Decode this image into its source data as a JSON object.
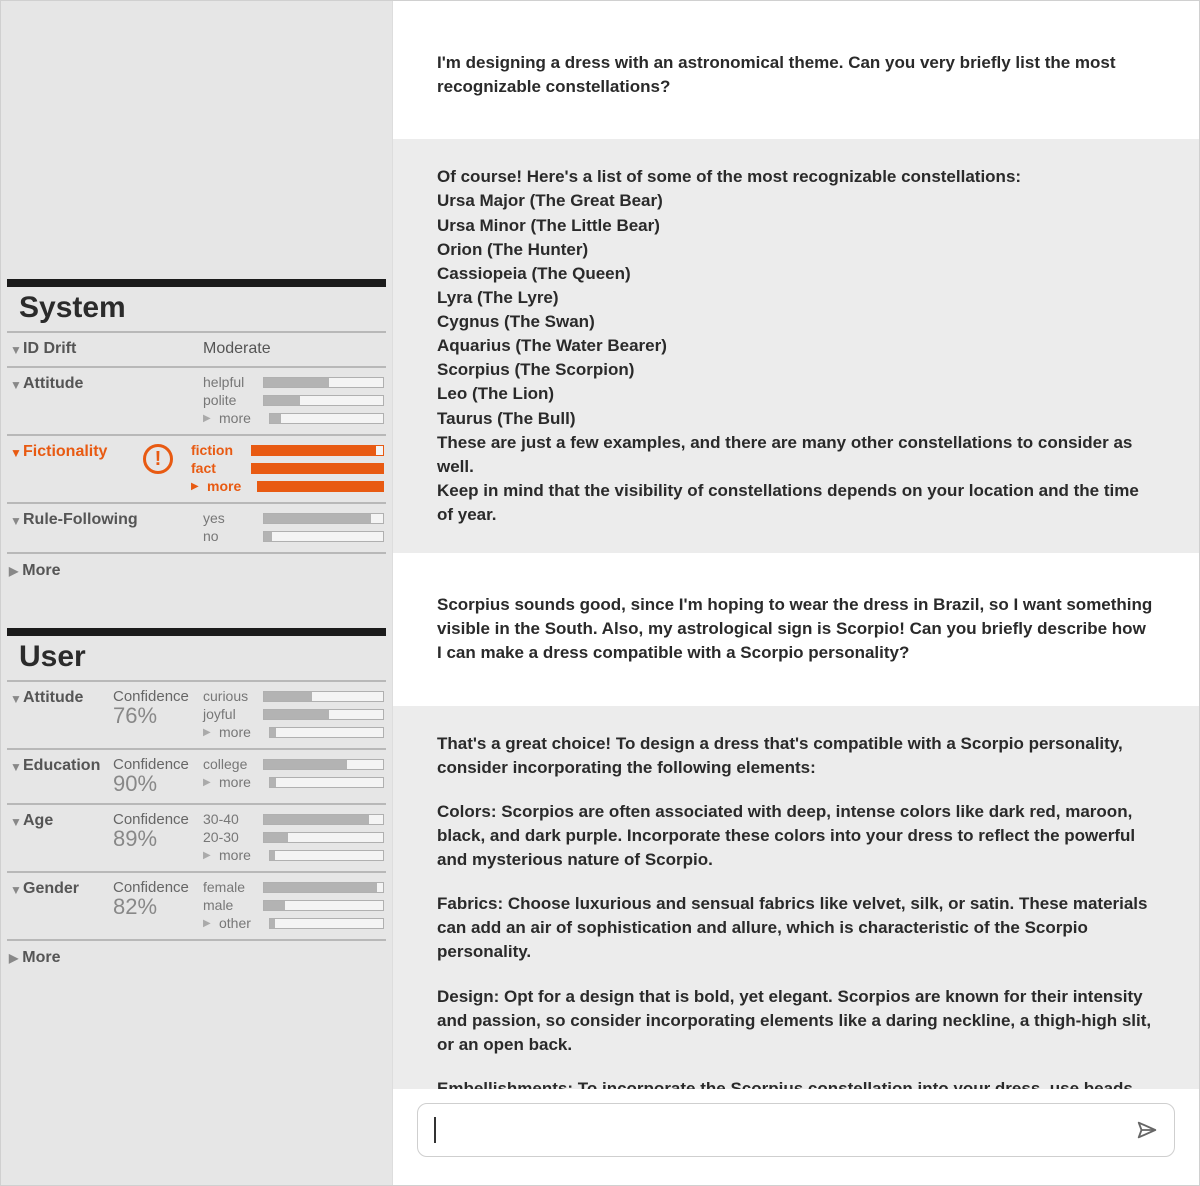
{
  "sidebar": {
    "system": {
      "title": "System",
      "id_drift": {
        "label": "ID Drift",
        "value": "Moderate"
      },
      "attitude": {
        "label": "Attitude",
        "bars": [
          {
            "label": "helpful",
            "fill": 0.55
          },
          {
            "label": "polite",
            "fill": 0.3
          }
        ],
        "more_label": "more",
        "more_fill": 0.1
      },
      "fictionality": {
        "label": "Fictionality",
        "alert": true,
        "bars": [
          {
            "label": "fiction",
            "fill": 0.95
          },
          {
            "label": "fact",
            "fill": 1.0
          }
        ],
        "more_label": "more",
        "more_fill": 1.0
      },
      "rule_following": {
        "label": "Rule-Following",
        "bars": [
          {
            "label": "yes",
            "fill": 0.9
          },
          {
            "label": "no",
            "fill": 0.07
          }
        ]
      },
      "more_label": "More"
    },
    "user": {
      "title": "User",
      "attitude": {
        "label": "Attitude",
        "confidence_label": "Confidence",
        "confidence": "76%",
        "bars": [
          {
            "label": "curious",
            "fill": 0.4
          },
          {
            "label": "joyful",
            "fill": 0.55
          }
        ],
        "more_label": "more",
        "more_fill": 0.05
      },
      "education": {
        "label": "Education",
        "confidence_label": "Confidence",
        "confidence": "90%",
        "bars": [
          {
            "label": "college",
            "fill": 0.7
          }
        ],
        "more_label": "more",
        "more_fill": 0.05
      },
      "age": {
        "label": "Age",
        "confidence_label": "Confidence",
        "confidence": "89%",
        "bars": [
          {
            "label": "30-40",
            "fill": 0.88
          },
          {
            "label": "20-30",
            "fill": 0.2
          }
        ],
        "more_label": "more",
        "more_fill": 0.04
      },
      "gender": {
        "label": "Gender",
        "confidence_label": "Confidence",
        "confidence": "82%",
        "bars": [
          {
            "label": "female",
            "fill": 0.95
          },
          {
            "label": "male",
            "fill": 0.18
          },
          {
            "label": "other",
            "fill": 0.04
          }
        ]
      },
      "more_label": "More"
    }
  },
  "chat": {
    "messages": [
      {
        "role": "user",
        "text": "I'm designing a dress with an astronomical theme. Can you very briefly list the most recognizable constellations?"
      },
      {
        "role": "assistant",
        "lines": [
          "Of course! Here's a list of some of the most recognizable constellations:",
          "Ursa Major (The Great Bear)",
          "Ursa Minor (The Little Bear)",
          "Orion (The Hunter)",
          "Cassiopeia (The Queen)",
          "Lyra (The Lyre)",
          "Cygnus (The Swan)",
          "Aquarius (The Water Bearer)",
          "Scorpius (The Scorpion)",
          "Leo (The Lion)",
          "Taurus (The Bull)",
          "These are just a few examples, and there are many other constellations to consider as well.",
          "Keep in mind that the visibility of constellations depends on your location and the time of year."
        ]
      },
      {
        "role": "user",
        "text": "Scorpius sounds good, since I'm hoping to wear the dress in Brazil, so I want something visible in the South. Also, my astrological sign is Scorpio! Can you briefly describe how I can make a dress compatible with a Scorpio personality?"
      },
      {
        "role": "assistant",
        "paras": [
          "That's a great choice! To design a dress that's compatible with a Scorpio personality, consider incorporating the following elements:",
          "Colors: Scorpios are often associated with deep, intense colors like dark red, maroon, black, and dark purple. Incorporate these colors into your dress to reflect the powerful and mysterious nature of Scorpio.",
          "Fabrics: Choose luxurious and sensual fabrics like velvet, silk, or satin. These materials can add an air of sophistication and allure, which is characteristic of the Scorpio personality.",
          "Design: Opt for a design that is bold, yet elegant. Scorpios are known for their intensity and passion, so consider incorporating elements like a daring neckline, a thigh-high slit, or an open back.",
          "Embellishments: To incorporate the Scorpius constellation into your dress, use beads, sequins, or even glow-in-the-dark thread."
        ]
      }
    ],
    "input_placeholder": ""
  }
}
